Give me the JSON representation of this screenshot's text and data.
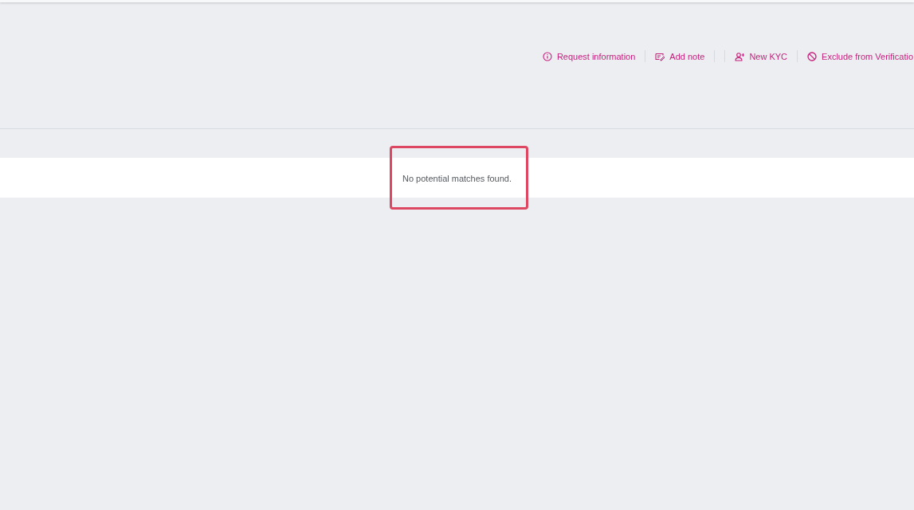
{
  "toolbar": {
    "items": [
      {
        "kind": "action",
        "label": "Request information"
      },
      {
        "kind": "divider"
      },
      {
        "kind": "action",
        "label": "Add note"
      },
      {
        "kind": "divider"
      },
      {
        "kind": "divider"
      },
      {
        "kind": "action",
        "label": "New KYC"
      },
      {
        "kind": "divider"
      },
      {
        "kind": "action",
        "label": "Exclude from Verificatio"
      }
    ]
  },
  "results": {
    "message": "No potential matches found.",
    "highlighted": true
  }
}
